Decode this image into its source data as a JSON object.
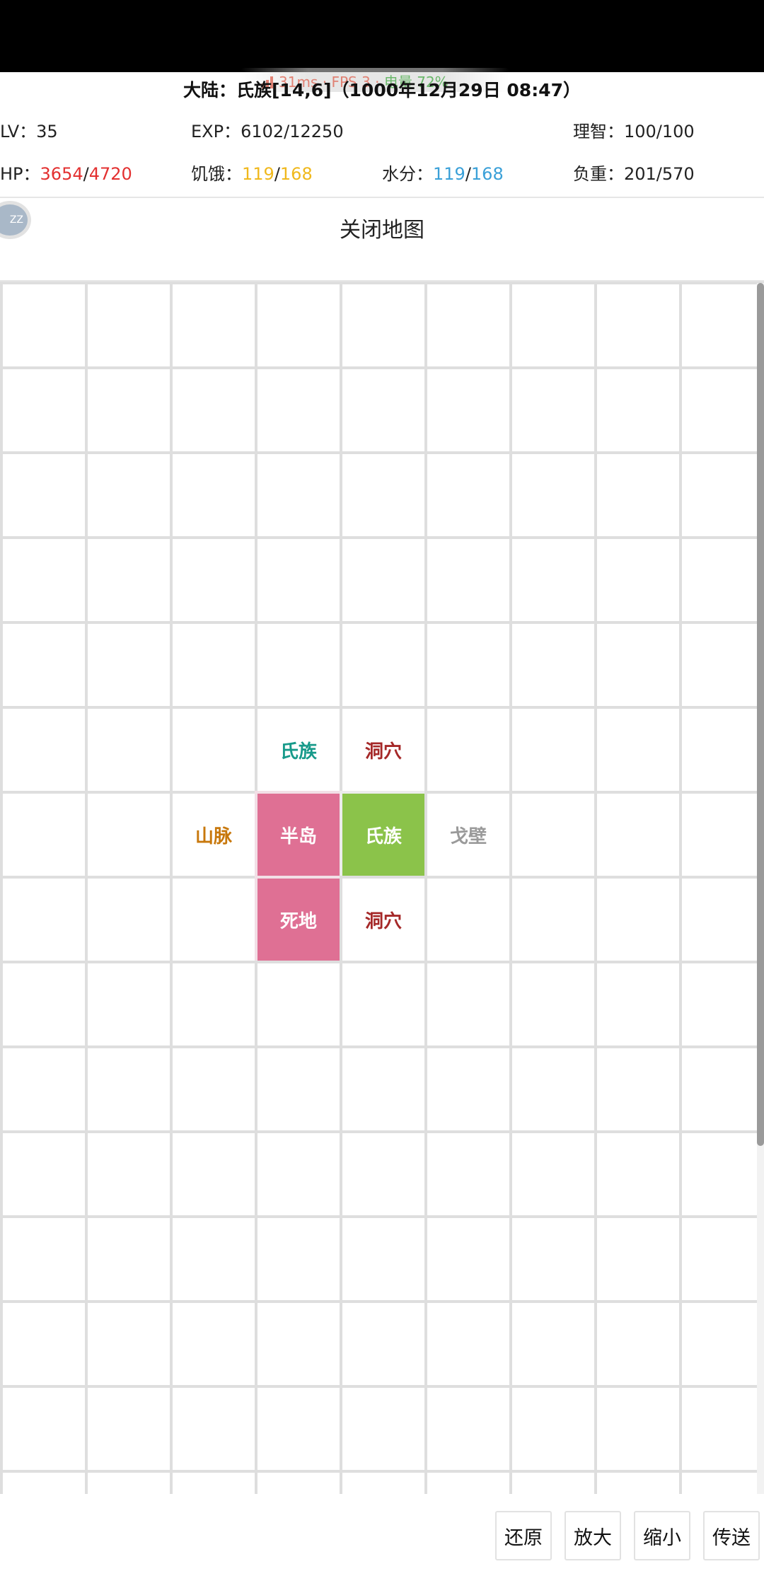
{
  "overlay": {
    "latency": "31ms",
    "fps": "FPS 3",
    "battery": "电量 72%",
    "separator": "·"
  },
  "header": {
    "location_title": "大陆：氏族[14,6]（1000年12月29日 08:47）"
  },
  "stats": {
    "lv_label": "LV：",
    "lv_value": "35",
    "exp_label": "EXP：",
    "exp_value": "6102/12250",
    "sanity_label": "理智：",
    "sanity_value": "100/100",
    "hp_label": "HP：",
    "hp_current": "3654",
    "hp_max": "4720",
    "hunger_label": "饥饿：",
    "hunger_current": "119",
    "hunger_max": "168",
    "water_label": "水分：",
    "water_current": "119",
    "water_max": "168",
    "load_label": "负重：",
    "load_value": "201/570",
    "slash": "/"
  },
  "avatar": {
    "text": "ZZ"
  },
  "map_header": {
    "close_label": "关闭地图"
  },
  "map": {
    "cols": 9,
    "rows": 15,
    "cells": [
      {
        "row": 5,
        "col": 3,
        "label": "氏族",
        "color": "#179a8a",
        "bg": "#ffffff"
      },
      {
        "row": 5,
        "col": 4,
        "label": "洞穴",
        "color": "#a52828",
        "bg": "#ffffff"
      },
      {
        "row": 6,
        "col": 2,
        "label": "山脉",
        "color": "#c8780c",
        "bg": "#ffffff"
      },
      {
        "row": 6,
        "col": 3,
        "label": "半岛",
        "color": "#ffffff",
        "bg": "#df7094"
      },
      {
        "row": 6,
        "col": 4,
        "label": "氏族",
        "color": "#ffffff",
        "bg": "#8bc34a"
      },
      {
        "row": 6,
        "col": 5,
        "label": "戈壁",
        "color": "#9a9a9a",
        "bg": "#ffffff"
      },
      {
        "row": 7,
        "col": 3,
        "label": "死地",
        "color": "#ffffff",
        "bg": "#df7094"
      },
      {
        "row": 7,
        "col": 4,
        "label": "洞穴",
        "color": "#a52828",
        "bg": "#ffffff"
      }
    ]
  },
  "buttons": {
    "reset": "还原",
    "zoom_in": "放大",
    "zoom_out": "缩小",
    "teleport": "传送"
  }
}
